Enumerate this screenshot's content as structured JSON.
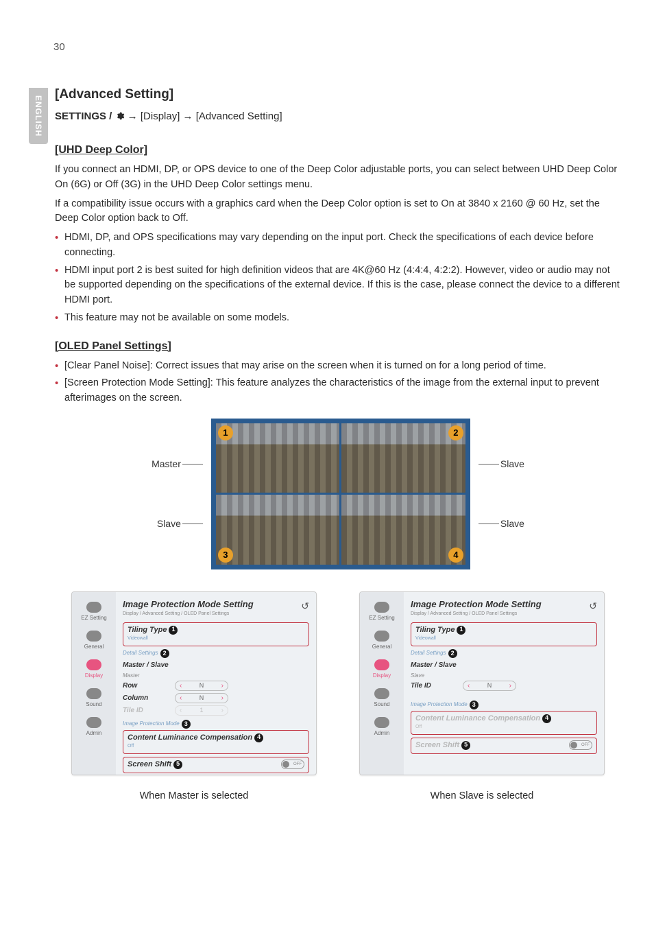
{
  "page_number": "30",
  "lang_tab": "ENGLISH",
  "h_adv": "[Advanced Setting]",
  "path": {
    "settings": "SETTINGS / ",
    "arrow": " → ",
    "display": "[Display]",
    "adv": "[Advanced Setting]"
  },
  "h_uhd": "[UHD Deep Color]",
  "uhd_p1": "If you connect an HDMI, DP, or OPS device to one of the Deep Color adjustable ports, you can select between UHD Deep Color On (6G) or Off (3G) in the UHD Deep Color settings menu.",
  "uhd_p2": "If a compatibility issue occurs with a graphics card when the Deep Color option is set to On at 3840 x 2160 @ 60 Hz, set the Deep Color option back to Off.",
  "uhd_li1": "HDMI, DP, and OPS specifications may vary depending on the input port. Check the specifications of each device before connecting.",
  "uhd_li2": "HDMI input port 2 is best suited for high definition videos that are 4K@60 Hz (4:4:4, 4:2:2). However, video or audio may not be supported depending on the specifications of the external device. If this is the case, please connect the device to a different HDMI port.",
  "uhd_li3": "This feature may not be available on some models.",
  "h_oled": "[OLED Panel Settings]",
  "oled_li1": "[Clear Panel Noise]: Correct issues that may arise on the screen when it is turned on for a long period of time.",
  "oled_li2": "[Screen Protection Mode Setting]: This feature analyzes the characteristics of the image from the external input to prevent afterimages on the screen.",
  "diag": {
    "master": "Master",
    "slave": "Slave",
    "n1": "1",
    "n2": "2",
    "n3": "3",
    "n4": "4"
  },
  "sidebar": {
    "ez": "EZ Setting",
    "general": "General",
    "display": "Display",
    "sound": "Sound",
    "admin": "Admin"
  },
  "panel": {
    "title": "Image Protection Mode Setting",
    "breadcrumb": "Display / Advanced Setting / OLED Panel Settings",
    "tiling_type": "Tiling Type",
    "videowall": "Videowall",
    "detail_settings": "Detail Settings",
    "master_slave": "Master / Slave",
    "master_val": "Master",
    "slave_val": "Slave",
    "row": "Row",
    "column": "Column",
    "tile_id": "Tile ID",
    "n": "N",
    "one": "1",
    "ipm": "Image Protection Mode",
    "clc": "Content Luminance Compensation",
    "off": "Off",
    "ss": "Screen Shift",
    "toggle_off": "OFF",
    "c1": "1",
    "c2": "2",
    "c3": "3",
    "c4": "4",
    "c5": "5"
  },
  "cap_master": "When Master is selected",
  "cap_slave": "When Slave is selected"
}
